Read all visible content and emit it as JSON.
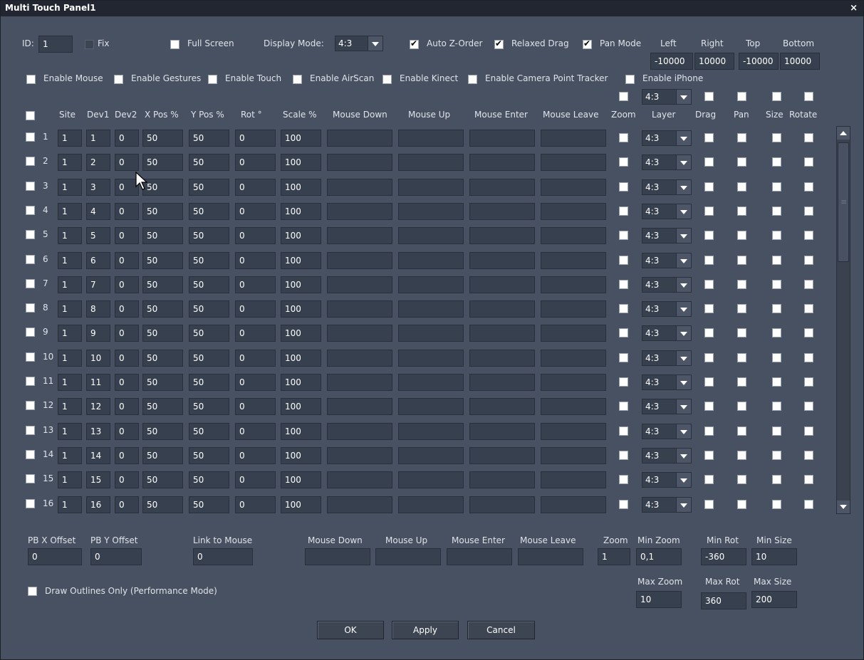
{
  "window": {
    "title": "Multi Touch Panel1",
    "close_glyph": "×"
  },
  "top": {
    "id_label": "ID:",
    "id_value": "1",
    "fix_label": "Fix",
    "fullscreen_label": "Full Screen",
    "display_mode_label": "Display Mode:",
    "display_mode_value": "4:3",
    "auto_zorder_label": "Auto Z-Order",
    "relaxed_drag_label": "Relaxed Drag",
    "pan_mode_label": "Pan Mode",
    "left_label": "Left",
    "left_value": "-10000",
    "right_label": "Right",
    "right_value": "10000",
    "top_label": "Top",
    "top_value": "-10000",
    "bottom_label": "Bottom",
    "bottom_value": "10000"
  },
  "enables": [
    {
      "label": "Enable Mouse"
    },
    {
      "label": "Enable Gestures"
    },
    {
      "label": "Enable Touch"
    },
    {
      "label": "Enable AirScan"
    },
    {
      "label": "Enable Kinect"
    },
    {
      "label": "Enable Camera Point Tracker"
    },
    {
      "label": "Enable iPhone"
    }
  ],
  "header_layer_value": "4:3",
  "columns": {
    "site": "Site",
    "dev1": "Dev1",
    "dev2": "Dev2",
    "xpos": "X Pos %",
    "ypos": "Y Pos %",
    "rot": "Rot °",
    "scale": "Scale %",
    "mouse_down": "Mouse Down",
    "mouse_up": "Mouse Up",
    "mouse_enter": "Mouse Enter",
    "mouse_leave": "Mouse Leave",
    "zoom": "Zoom",
    "layer": "Layer",
    "drag": "Drag",
    "pan": "Pan",
    "size": "Size",
    "rotate": "Rotate"
  },
  "rows": [
    {
      "num": "1",
      "site": "1",
      "dev1": "1",
      "dev2": "0",
      "x": "50",
      "y": "50",
      "rot": "0",
      "scale": "100",
      "layer": "4:3"
    },
    {
      "num": "2",
      "site": "1",
      "dev1": "2",
      "dev2": "0",
      "x": "50",
      "y": "50",
      "rot": "0",
      "scale": "100",
      "layer": "4:3"
    },
    {
      "num": "3",
      "site": "1",
      "dev1": "3",
      "dev2": "0",
      "x": "50",
      "y": "50",
      "rot": "0",
      "scale": "100",
      "layer": "4:3"
    },
    {
      "num": "4",
      "site": "1",
      "dev1": "4",
      "dev2": "0",
      "x": "50",
      "y": "50",
      "rot": "0",
      "scale": "100",
      "layer": "4:3"
    },
    {
      "num": "5",
      "site": "1",
      "dev1": "5",
      "dev2": "0",
      "x": "50",
      "y": "50",
      "rot": "0",
      "scale": "100",
      "layer": "4:3"
    },
    {
      "num": "6",
      "site": "1",
      "dev1": "6",
      "dev2": "0",
      "x": "50",
      "y": "50",
      "rot": "0",
      "scale": "100",
      "layer": "4:3"
    },
    {
      "num": "7",
      "site": "1",
      "dev1": "7",
      "dev2": "0",
      "x": "50",
      "y": "50",
      "rot": "0",
      "scale": "100",
      "layer": "4:3"
    },
    {
      "num": "8",
      "site": "1",
      "dev1": "8",
      "dev2": "0",
      "x": "50",
      "y": "50",
      "rot": "0",
      "scale": "100",
      "layer": "4:3"
    },
    {
      "num": "9",
      "site": "1",
      "dev1": "9",
      "dev2": "0",
      "x": "50",
      "y": "50",
      "rot": "0",
      "scale": "100",
      "layer": "4:3"
    },
    {
      "num": "10",
      "site": "1",
      "dev1": "10",
      "dev2": "0",
      "x": "50",
      "y": "50",
      "rot": "0",
      "scale": "100",
      "layer": "4:3"
    },
    {
      "num": "11",
      "site": "1",
      "dev1": "11",
      "dev2": "0",
      "x": "50",
      "y": "50",
      "rot": "0",
      "scale": "100",
      "layer": "4:3"
    },
    {
      "num": "12",
      "site": "1",
      "dev1": "12",
      "dev2": "0",
      "x": "50",
      "y": "50",
      "rot": "0",
      "scale": "100",
      "layer": "4:3"
    },
    {
      "num": "13",
      "site": "1",
      "dev1": "13",
      "dev2": "0",
      "x": "50",
      "y": "50",
      "rot": "0",
      "scale": "100",
      "layer": "4:3"
    },
    {
      "num": "14",
      "site": "1",
      "dev1": "14",
      "dev2": "0",
      "x": "50",
      "y": "50",
      "rot": "0",
      "scale": "100",
      "layer": "4:3"
    },
    {
      "num": "15",
      "site": "1",
      "dev1": "15",
      "dev2": "0",
      "x": "50",
      "y": "50",
      "rot": "0",
      "scale": "100",
      "layer": "4:3"
    },
    {
      "num": "16",
      "site": "1",
      "dev1": "16",
      "dev2": "0",
      "x": "50",
      "y": "50",
      "rot": "0",
      "scale": "100",
      "layer": "4:3"
    }
  ],
  "bottom": {
    "pbx_label": "PB X Offset",
    "pbx_value": "0",
    "pby_label": "PB Y Offset",
    "pby_value": "0",
    "link_label": "Link to Mouse",
    "link_value": "0",
    "mouse_down_label": "Mouse Down",
    "mouse_up_label": "Mouse Up",
    "mouse_enter_label": "Mouse Enter",
    "mouse_leave_label": "Mouse Leave",
    "zoom_label": "Zoom",
    "zoom_value": "1",
    "min_zoom_label": "Min Zoom",
    "min_zoom_value": "0,1",
    "min_rot_label": "Min Rot",
    "min_rot_value": "-360",
    "min_size_label": "Min Size",
    "min_size_value": "10",
    "max_zoom_label": "Max Zoom",
    "max_zoom_value": "10",
    "max_rot_label": "Max Rot",
    "max_rot_value": "360",
    "max_size_label": "Max Size",
    "max_size_value": "200",
    "outlines_label": "Draw Outlines Only (Performance Mode)"
  },
  "buttons": {
    "ok": "OK",
    "apply": "Apply",
    "cancel": "Cancel"
  },
  "colors": {
    "window_bg": "#485161",
    "field_bg": "#37404e",
    "title_bg": "#212630"
  }
}
